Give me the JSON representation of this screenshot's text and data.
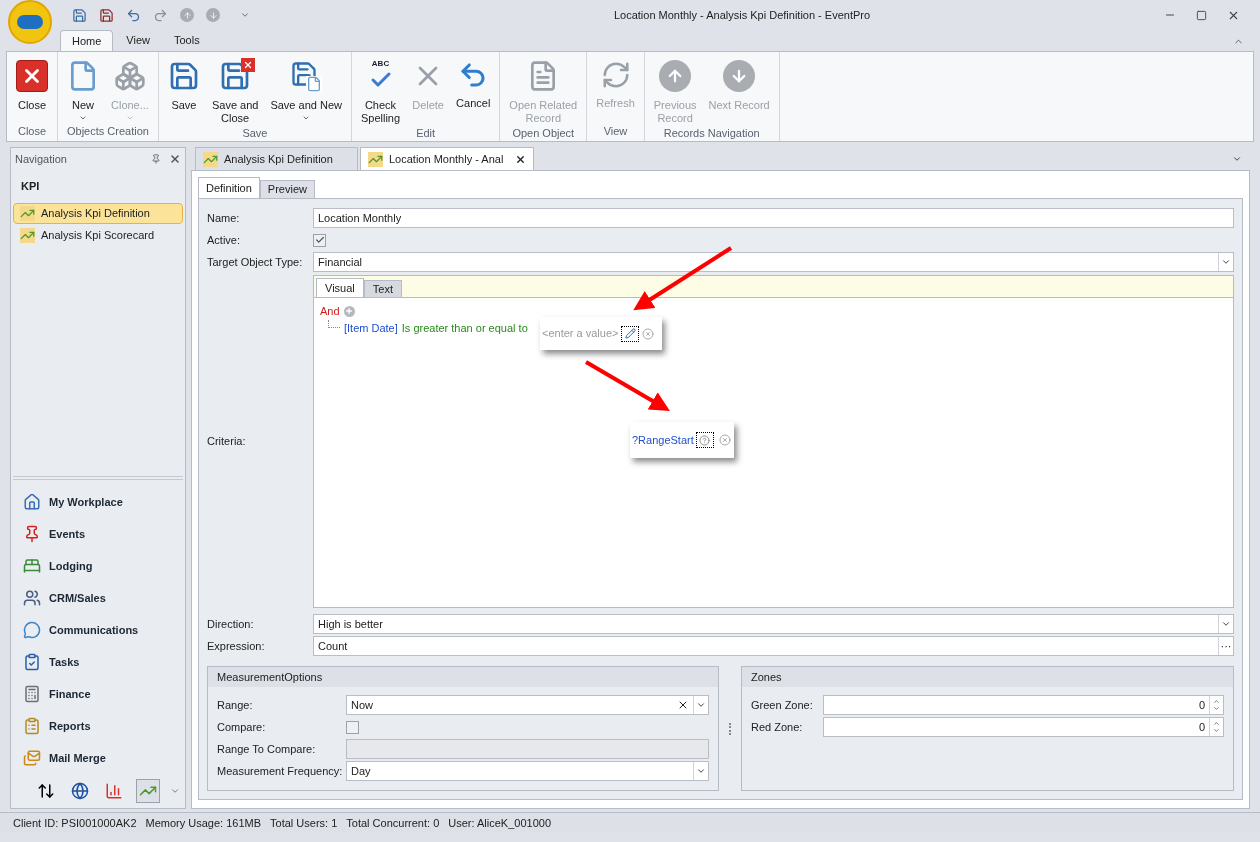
{
  "window": {
    "title": "Location Monthly - Analysis Kpi Definition - EventPro"
  },
  "ribbon_tabs": [
    {
      "label": "Home",
      "selected": true
    },
    {
      "label": "View",
      "selected": false
    },
    {
      "label": "Tools",
      "selected": false
    }
  ],
  "ribbon_groups": [
    {
      "label": "Close",
      "buttons": [
        {
          "lines": [
            "Close"
          ],
          "kind": "close",
          "disabled": false,
          "dropdown": false
        }
      ]
    },
    {
      "label": "Objects Creation",
      "buttons": [
        {
          "lines": [
            "New"
          ],
          "kind": "new",
          "disabled": false,
          "dropdown": true
        },
        {
          "lines": [
            "Clone..."
          ],
          "kind": "clone",
          "disabled": true,
          "dropdown": true
        }
      ]
    },
    {
      "label": "Save",
      "buttons": [
        {
          "lines": [
            "Save"
          ],
          "kind": "save",
          "disabled": false,
          "dropdown": false
        },
        {
          "lines": [
            "Save and",
            "Close"
          ],
          "kind": "save-close",
          "disabled": false,
          "dropdown": false
        },
        {
          "lines": [
            "Save and New"
          ],
          "kind": "save-new",
          "disabled": false,
          "dropdown": true
        }
      ]
    },
    {
      "label": "Edit",
      "buttons": [
        {
          "lines": [
            "Check",
            "Spelling"
          ],
          "kind": "spell",
          "icon_text": "ABC",
          "disabled": false,
          "dropdown": false
        },
        {
          "lines": [
            "Delete"
          ],
          "kind": "delete",
          "disabled": true,
          "dropdown": false
        },
        {
          "lines": [
            "Cancel"
          ],
          "kind": "undo",
          "disabled": false,
          "dropdown": false
        }
      ]
    },
    {
      "label": "Open Object",
      "buttons": [
        {
          "lines": [
            "Open Related",
            "Record"
          ],
          "kind": "open",
          "disabled": true,
          "dropdown": false
        }
      ]
    },
    {
      "label": "View",
      "buttons": [
        {
          "lines": [
            "Refresh"
          ],
          "kind": "refresh",
          "disabled": true,
          "dropdown": false
        }
      ]
    },
    {
      "label": "Records Navigation",
      "buttons": [
        {
          "lines": [
            "Previous",
            "Record"
          ],
          "kind": "up",
          "disabled": true,
          "dropdown": false
        },
        {
          "lines": [
            "Next Record"
          ],
          "kind": "down",
          "disabled": true,
          "dropdown": false
        }
      ]
    }
  ],
  "navigation": {
    "title": "Navigation",
    "section": "KPI",
    "items": [
      {
        "label": "Analysis Kpi Definition",
        "selected": true
      },
      {
        "label": "Analysis Kpi Scorecard",
        "selected": false
      }
    ],
    "modules": [
      {
        "label": "My Workplace",
        "kind": "home"
      },
      {
        "label": "Events",
        "kind": "pin"
      },
      {
        "label": "Lodging",
        "kind": "bed"
      },
      {
        "label": "CRM/Sales",
        "kind": "crm"
      },
      {
        "label": "Communications",
        "kind": "chat"
      },
      {
        "label": "Tasks",
        "kind": "tasks"
      },
      {
        "label": "Finance",
        "kind": "calc"
      },
      {
        "label": "Reports",
        "kind": "report"
      },
      {
        "label": "Mail Merge",
        "kind": "mail"
      }
    ],
    "bottom_icons": [
      {
        "kind": "sort",
        "selected": false
      },
      {
        "kind": "globe",
        "selected": false
      },
      {
        "kind": "chart",
        "selected": false
      },
      {
        "kind": "kpi",
        "selected": true
      }
    ]
  },
  "document_tabs": [
    {
      "label": "Analysis Kpi Definition",
      "selected": false
    },
    {
      "label": "Location Monthly - Anal",
      "selected": true
    }
  ],
  "form_tabs": [
    {
      "label": "Definition",
      "selected": true
    },
    {
      "label": "Preview",
      "selected": false
    }
  ],
  "form": {
    "name": {
      "label": "Name:",
      "value": "Location Monthly"
    },
    "active": {
      "label": "Active:",
      "checked": true
    },
    "target_object_type": {
      "label": "Target Object Type:",
      "value": "Financial"
    },
    "criteria": {
      "label": "Criteria:",
      "tabs": [
        {
          "label": "Visual",
          "selected": true
        },
        {
          "label": "Text",
          "selected": false
        }
      ],
      "group_operator": "And",
      "condition": {
        "field": "[Item Date]",
        "operator": "Is greater than or equal to",
        "value_placeholder": "<enter a value>"
      },
      "parameter_value": "?RangeStart"
    },
    "direction": {
      "label": "Direction:",
      "value": "High is better"
    },
    "expression": {
      "label": "Expression:",
      "value": "Count",
      "button": "···"
    }
  },
  "measurement_options": {
    "title": "MeasurementOptions",
    "fields": [
      {
        "kind": "clear-combo",
        "label": "Range:",
        "value": "Now"
      },
      {
        "kind": "checkbox",
        "label": "Compare:",
        "checked": false
      },
      {
        "kind": "disabled",
        "label": "Range To Compare:"
      },
      {
        "kind": "combo",
        "label": "Measurement Frequency:",
        "value": "Day"
      }
    ]
  },
  "zones": {
    "title": "Zones",
    "fields": [
      {
        "label": "Green Zone:",
        "value": "0"
      },
      {
        "label": "Red Zone:",
        "value": "0"
      }
    ]
  },
  "status_bar": [
    "Client ID: PSI001000AK2",
    "Memory Usage: 161MB",
    "Total Users: 1",
    "Total Concurrent: 0",
    "User: AliceK_001000"
  ]
}
